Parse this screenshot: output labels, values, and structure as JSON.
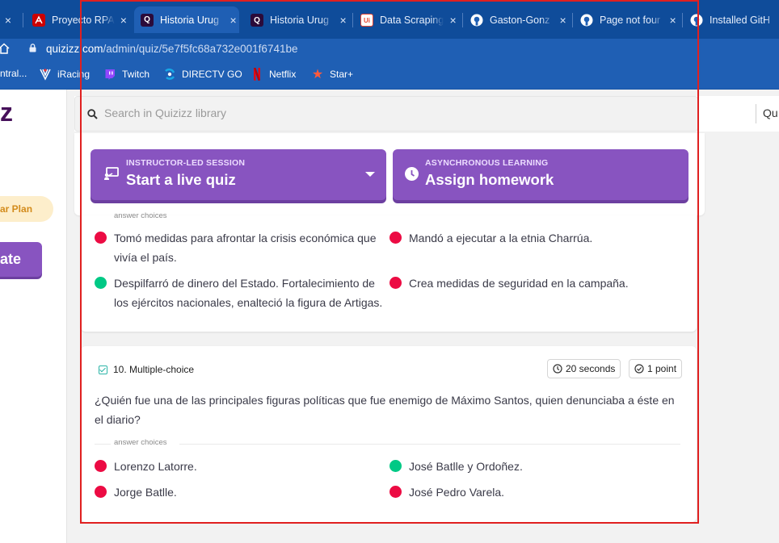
{
  "browser": {
    "tabs": [
      {
        "title": "",
        "icon": "partial-tab"
      },
      {
        "title": "Proyecto RPA",
        "icon": "pdf-icon"
      },
      {
        "title": "Historia Urug",
        "icon": "quizizz-icon",
        "active": true
      },
      {
        "title": "Historia Urug",
        "icon": "quizizz-icon"
      },
      {
        "title": "Data Scraping",
        "icon": "uipath-icon"
      },
      {
        "title": "Gaston-Gonz",
        "icon": "github-icon"
      },
      {
        "title": "Page not four",
        "icon": "github-icon"
      },
      {
        "title": "Installed GitH",
        "icon": "github-icon"
      }
    ],
    "close_glyph": "×",
    "url_host": "quizizz.com",
    "url_path": "/admin/quiz/5e7f5fc68a732e001f6741be",
    "bookmarks": [
      {
        "label": "ntral...",
        "icon": "none"
      },
      {
        "label": "iRacing",
        "icon": "iracing-icon"
      },
      {
        "label": "Twitch",
        "icon": "twitch-icon"
      },
      {
        "label": "DIRECTV GO",
        "icon": "directv-icon"
      },
      {
        "label": "Netflix",
        "icon": "netflix-icon"
      },
      {
        "label": "Star+",
        "icon": "star-icon"
      }
    ]
  },
  "sidebar": {
    "logo_fragment": "z",
    "plan_label": "ar Plan",
    "create_label": "ate"
  },
  "search": {
    "placeholder": "Search in Quizizz library",
    "right_text": "Qu"
  },
  "actions": {
    "live": {
      "kicker": "INSTRUCTOR-LED SESSION",
      "title": "Start a live quiz"
    },
    "homework": {
      "kicker": "ASYNCHRONOUS LEARNING",
      "title": "Assign homework"
    }
  },
  "question9": {
    "answers_label": "answer choices",
    "choices": [
      {
        "text": "Tomó medidas para afrontar la crisis económica que vivía el país.",
        "correct": false
      },
      {
        "text": "Mandó a ejecutar a la etnia Charrúa.",
        "correct": false
      },
      {
        "text": "Despilfarró de dinero del Estado. Fortalecimiento de los ejércitos nacionales, enalteció la figura de Artigas.",
        "correct": true
      },
      {
        "text": "Crea medidas de seguridad en la campaña.",
        "correct": false
      }
    ]
  },
  "question10": {
    "type_label": "10. Multiple-choice",
    "time_label": "20 seconds",
    "points_label": "1 point",
    "text": "¿Quién fue una de las principales figuras políticas que fue enemigo de Máximo Santos, quien denunciaba a éste en el diario?",
    "answers_label": "answer choices",
    "choices": [
      {
        "text": "Lorenzo Latorre.",
        "correct": false
      },
      {
        "text": "José Batlle y Ordoñez.",
        "correct": true
      },
      {
        "text": "Jorge Batlle.",
        "correct": false
      },
      {
        "text": "José Pedro Varela.",
        "correct": false
      }
    ]
  },
  "colors": {
    "browser_frame": "#0f4c9a",
    "accent_purple": "#8854c0",
    "correct": "#00c985",
    "incorrect": "#ec0b43",
    "highlight_frame": "#e02020"
  }
}
